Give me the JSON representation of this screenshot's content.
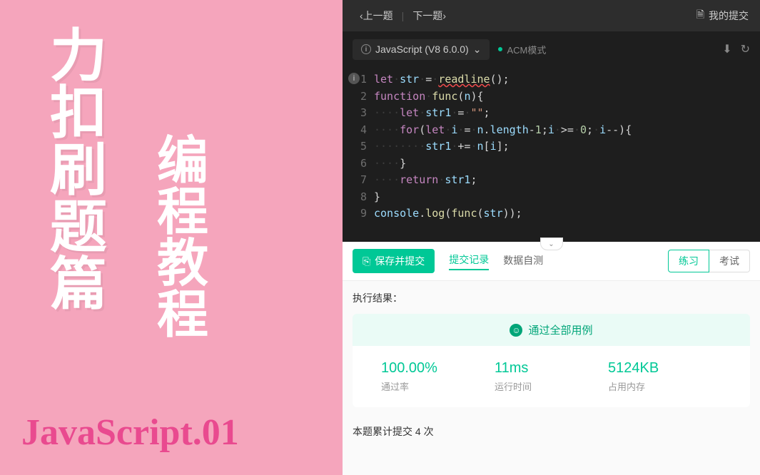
{
  "leftPanel": {
    "title1": [
      "力",
      "扣",
      "刷",
      "题",
      "篇"
    ],
    "title2": [
      "编",
      "程",
      "教",
      "程"
    ],
    "bottom": "JavaScript.01"
  },
  "topBar": {
    "prev": "上一题",
    "next": "下一题",
    "submissions": "我的提交"
  },
  "toolbar": {
    "lang": "JavaScript (V8 6.0.0)",
    "acm": "ACM模式"
  },
  "code": {
    "lines": [
      1,
      2,
      3,
      4,
      5,
      6,
      7,
      8,
      9
    ]
  },
  "actionBar": {
    "submit": "保存并提交",
    "tab_records": "提交记录",
    "tab_test": "数据自测",
    "mode_practice": "练习",
    "mode_exam": "考试"
  },
  "result": {
    "title": "执行结果：",
    "banner": "通过全部用例",
    "passRate": "100.00%",
    "passRateLabel": "通过率",
    "runtime": "11ms",
    "runtimeLabel": "运行时间",
    "memory": "5124KB",
    "memoryLabel": "占用内存",
    "summary": "本题累计提交 4 次"
  }
}
